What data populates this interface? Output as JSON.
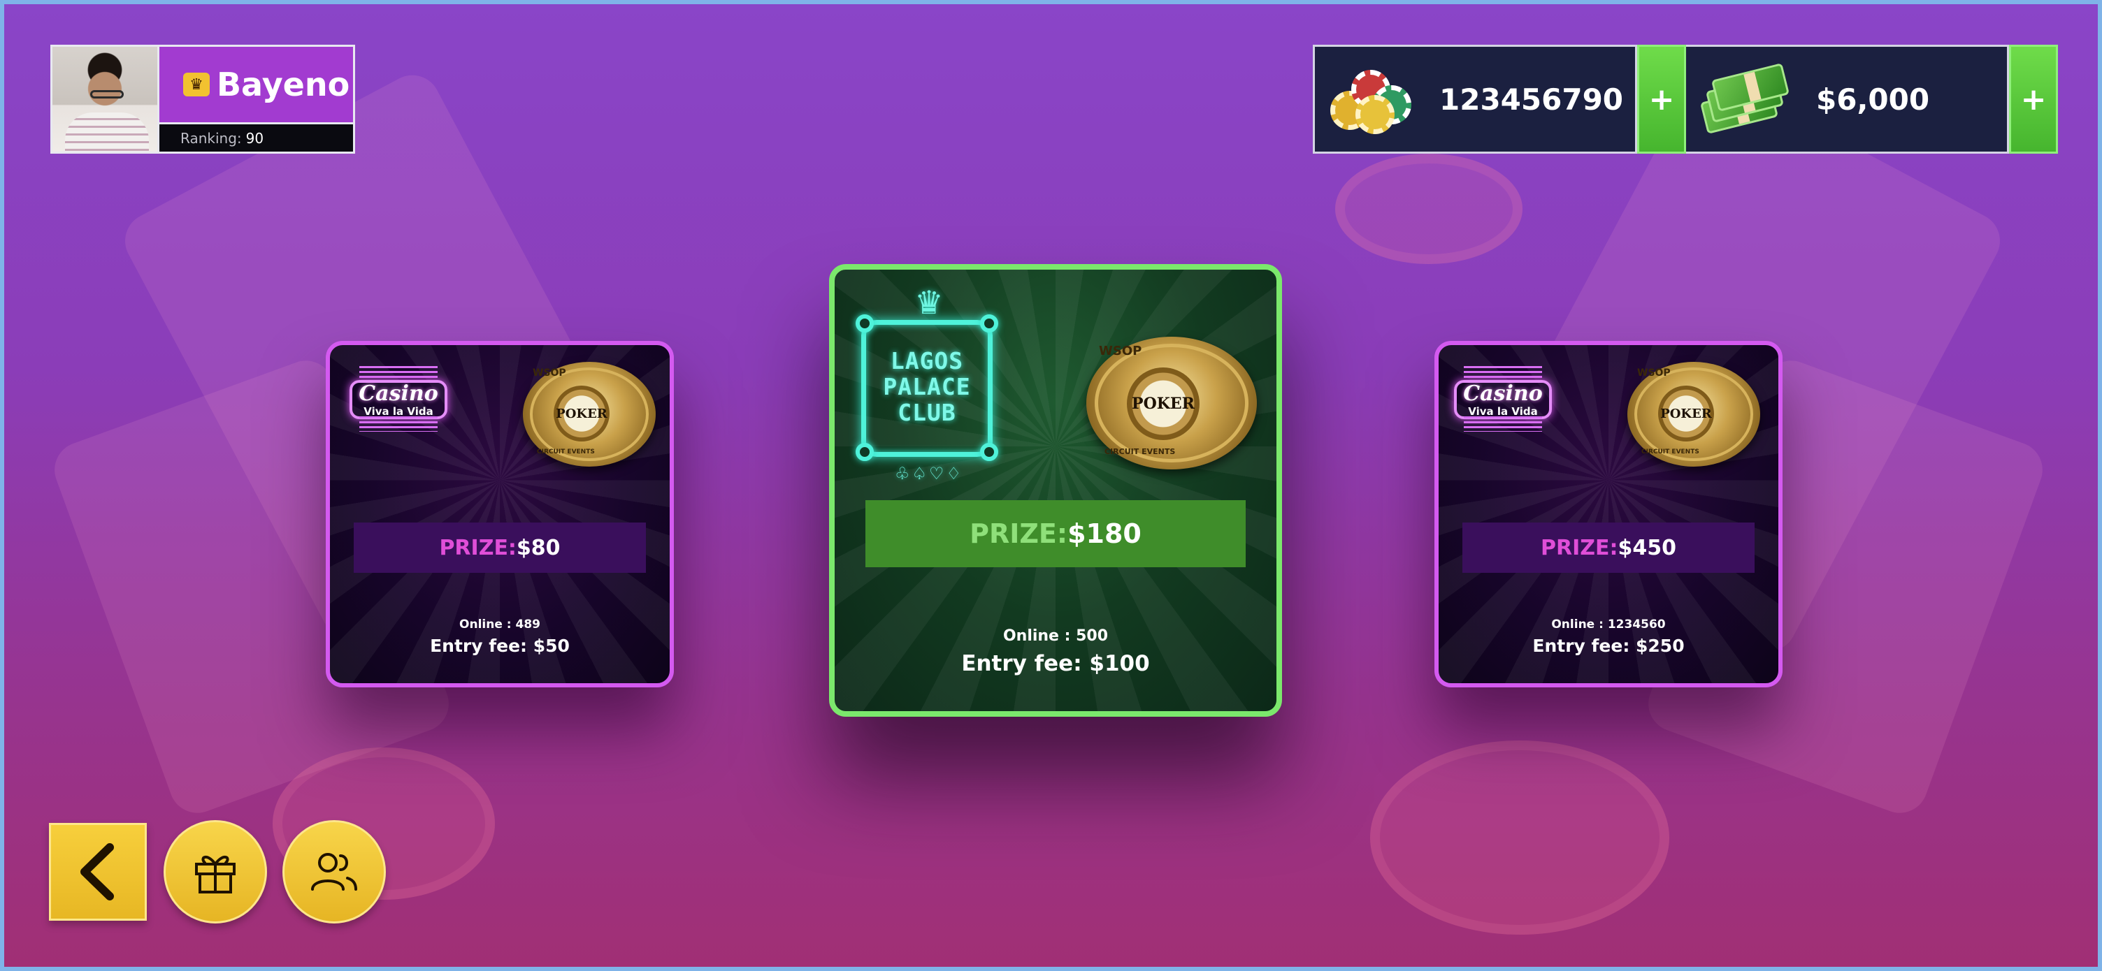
{
  "player": {
    "name": "Bayeno",
    "ranking_label": "Ranking:",
    "ranking_value": "90",
    "crown_icon": "crown-icon"
  },
  "currency": {
    "chips": {
      "value": "123456790",
      "icon": "poker-chips-icon",
      "plus": "+"
    },
    "cash": {
      "value": "$6,000",
      "icon": "cash-stack-icon",
      "plus": "+"
    }
  },
  "tables": [
    {
      "logo_word": "Casino",
      "logo_sub": "Viva la Vida",
      "ring_top": "WSOP",
      "ring_face": "POKER",
      "ring_side": "CIRCUIT EVENTS",
      "prize_label": "PRIZE:",
      "prize_value": "$80",
      "online": "Online : 489",
      "entry_fee": "Entry fee: $50",
      "selected": false
    },
    {
      "logo_lines": [
        "LAGOS",
        "PALACE",
        "CLUB"
      ],
      "logo_crown": "♛",
      "logo_suits": "♧♤♡♢",
      "ring_top": "WSOP",
      "ring_face": "POKER",
      "ring_side": "CIRCUIT EVENTS",
      "prize_label": "PRIZE:",
      "prize_value": "$180",
      "online": "Online : 500",
      "entry_fee": "Entry fee: $100",
      "selected": true
    },
    {
      "logo_word": "Casino",
      "logo_sub": "Viva la Vida",
      "ring_top": "WSOP",
      "ring_face": "POKER",
      "ring_side": "CIRCUIT EVENTS",
      "prize_label": "PRIZE:",
      "prize_value": "$450",
      "online": "Online : 1234560",
      "entry_fee": "Entry fee: $250",
      "selected": false
    }
  ],
  "buttons": {
    "back": {
      "icon": "chevron-left-icon",
      "glyph": "‹"
    },
    "gift": {
      "icon": "gift-icon"
    },
    "friends": {
      "icon": "users-icon"
    }
  },
  "colors": {
    "accent_purple": "#d45af0",
    "accent_green": "#7be86c",
    "prize_pink": "#e04ed8",
    "prize_green": "#7bd46a",
    "button_yellow": "#f2c230"
  }
}
